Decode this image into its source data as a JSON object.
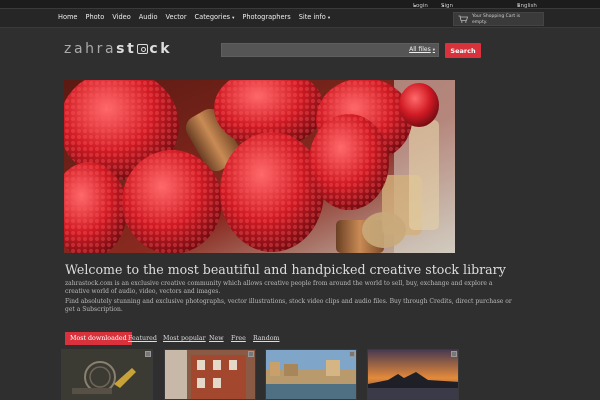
{
  "topbar": {
    "login": "Login",
    "signup": "Sign Up",
    "language": "English"
  },
  "nav": {
    "items": [
      "Home",
      "Photo",
      "Video",
      "Audio",
      "Vector",
      "Categories",
      "Photographers",
      "Site info"
    ]
  },
  "cart": {
    "line1": "Your Shopping Cart is",
    "line2": "empty."
  },
  "logo": {
    "part1": "zahra",
    "part2": "st",
    "part3": "ck"
  },
  "search": {
    "placeholder": "",
    "filter": "All files",
    "button": "Search"
  },
  "main": {
    "headline": "Welcome to the most beautiful and handpicked creative stock library",
    "paragraph1": "zahrastock.com is an exclusive creative community which allows creative people from around the world to sell, buy, exchange and explore a creative world of audio, video, vectors and images.",
    "paragraph2": "Find absolutely stunning and exclusive photographs, vector illustrations, stock video clips and audio files. Buy through Credits, direct purchase or get a Subscription."
  },
  "tabs": [
    "Most downloaded",
    "Featured",
    "Most popular",
    "New",
    "Free",
    "Random"
  ],
  "colors": {
    "accent": "#d9323c",
    "background": "#2f2f2f",
    "bar": "#262626"
  }
}
